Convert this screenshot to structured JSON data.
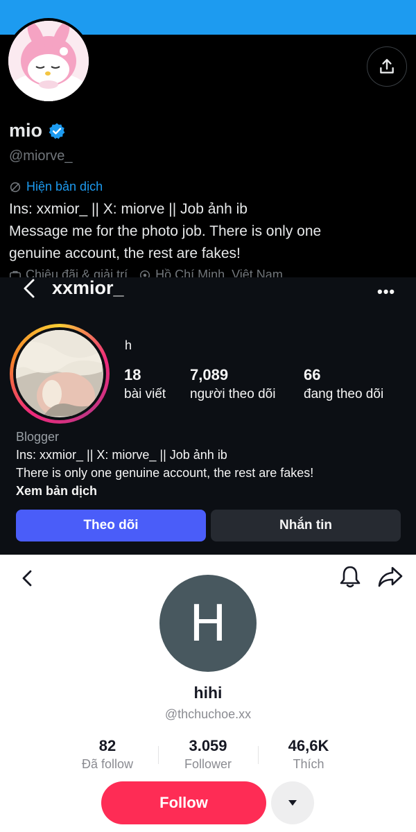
{
  "x_profile": {
    "display_name": "mio",
    "handle": "@miorve_",
    "translate_label": "Hiện bản dịch",
    "bio_lines": [
      "Ins: xxmior_ || X: miorve || Job ảnh ib",
      "Message me for the photo job. There is only one",
      "genuine account, the rest are fakes!"
    ],
    "meta_category": "Chiêu đãi & giải trí",
    "meta_location": "Hồ Chí Minh, Việt Nam",
    "colors": {
      "banner": "#1d9bf0",
      "verified": "#1d9bf0",
      "link": "#1d9bf0"
    },
    "icons": [
      "share-icon",
      "verified-badge-icon",
      "translate-icon",
      "briefcase-icon",
      "location-pin-icon"
    ]
  },
  "instagram_profile": {
    "username": "xxmior_",
    "more_label": "•••",
    "display_name": "h",
    "stats": [
      {
        "value": "18",
        "label": "bài viết"
      },
      {
        "value": "7,089",
        "label": "người theo dõi"
      },
      {
        "value": "66",
        "label": "đang theo dõi"
      }
    ],
    "category": "Blogger",
    "bio_lines": [
      "Ins: xxmior_ || X: miorve_ || Job ảnh ib",
      "There is only one genuine account, the rest are fakes!"
    ],
    "see_translation": "Xem bản dịch",
    "follow_label": "Theo dõi",
    "message_label": "Nhắn tin",
    "colors": {
      "follow": "#4a5df9",
      "message": "#262a31"
    },
    "icons": [
      "back-icon",
      "more-icon"
    ]
  },
  "tiktok_profile": {
    "avatar_letter": "H",
    "display_name": "hihi",
    "handle": "@thchuchoe.xx",
    "stats": [
      {
        "value": "82",
        "label": "Đã follow"
      },
      {
        "value": "3.059",
        "label": "Follower"
      },
      {
        "value": "46,6K",
        "label": "Thích"
      }
    ],
    "follow_label": "Follow",
    "colors": {
      "follow": "#fe2c55",
      "avatar_bg": "#48585f"
    },
    "icons": [
      "back-icon",
      "bell-icon",
      "share-arrow-icon",
      "caret-down-icon"
    ]
  }
}
